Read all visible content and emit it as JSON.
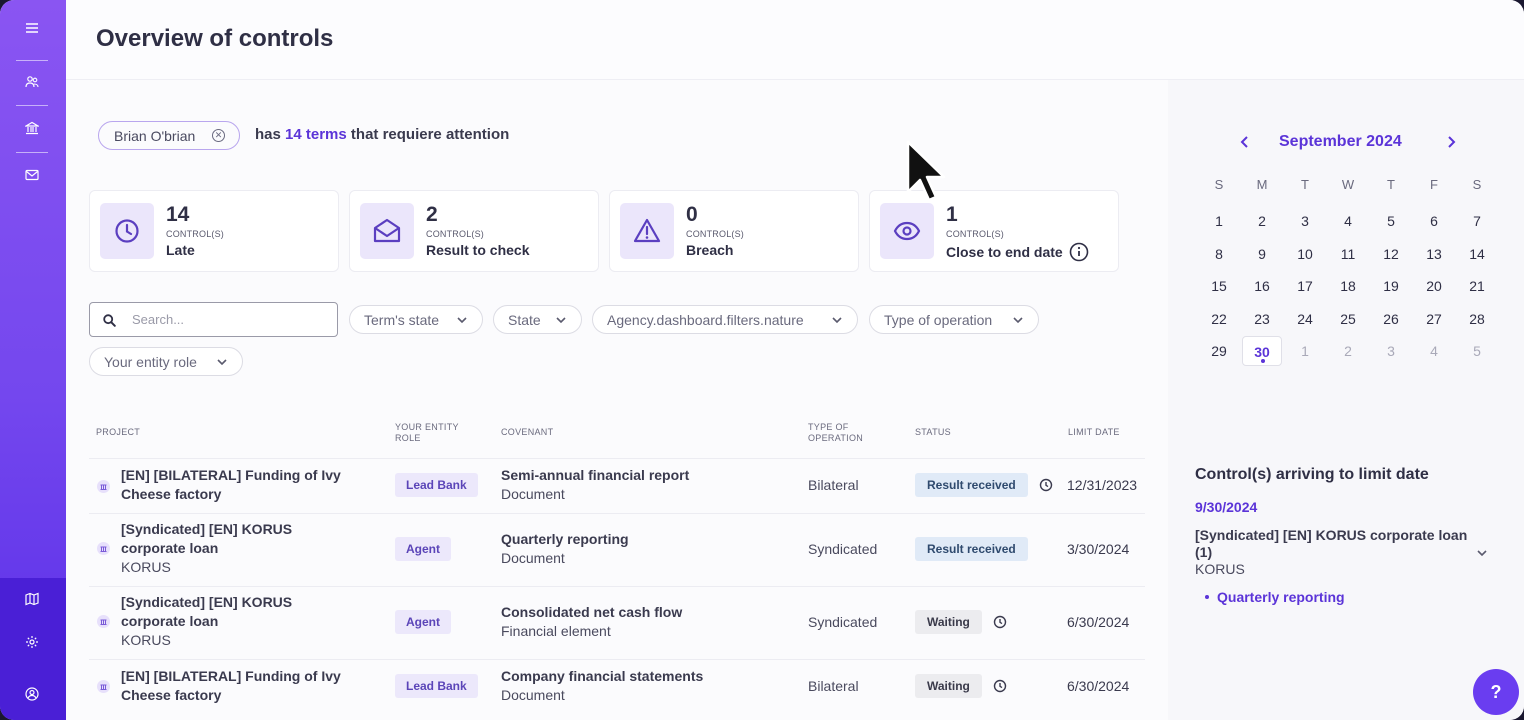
{
  "page": {
    "title": "Overview of controls"
  },
  "attention": {
    "user": "Brian O'brian",
    "prefix": "has",
    "highlight": "14 terms",
    "suffix": "that requiere attention"
  },
  "cards": [
    {
      "value": "14",
      "unit": "CONTROL(S)",
      "label": "Late",
      "icon": "clock-icon"
    },
    {
      "value": "2",
      "unit": "CONTROL(S)",
      "label": "Result to check",
      "icon": "envelope-open-icon"
    },
    {
      "value": "0",
      "unit": "CONTROL(S)",
      "label": "Breach",
      "icon": "warning-icon"
    },
    {
      "value": "1",
      "unit": "CONTROL(S)",
      "label": "Close to end date",
      "icon": "eye-icon"
    }
  ],
  "search": {
    "placeholder": "Search..."
  },
  "filters": [
    "Term's state",
    "State",
    "Agency.dashboard.filters.nature",
    "Type of operation",
    "Your entity role"
  ],
  "table": {
    "headers": {
      "project": "PROJECT",
      "role": "YOUR ENTITY ROLE",
      "covenant": "COVENANT",
      "operation": "TYPE OF OPERATION",
      "status": "STATUS",
      "limit": "LIMIT DATE"
    },
    "rows": [
      {
        "project": "[EN] [BILATERAL] Funding of Ivy Cheese factory",
        "project_sub": "",
        "role": "Lead Bank",
        "covenant": "Semi-annual financial report",
        "covenant_type": "Document",
        "operation": "Bilateral",
        "status": "Result received",
        "date": "12/31/2023"
      },
      {
        "project": "[Syndicated] [EN] KORUS corporate loan",
        "project_sub": "KORUS",
        "role": "Agent",
        "covenant": "Quarterly reporting",
        "covenant_type": "Document",
        "operation": "Syndicated",
        "status": "Result received",
        "date": "3/30/2024"
      },
      {
        "project": "[Syndicated] [EN] KORUS corporate loan",
        "project_sub": "KORUS",
        "role": "Agent",
        "covenant": "Consolidated net cash flow",
        "covenant_type": "Financial element",
        "operation": "Syndicated",
        "status": "Waiting",
        "date": "6/30/2024"
      },
      {
        "project": "[EN] [BILATERAL] Funding of Ivy Cheese factory",
        "project_sub": "",
        "role": "Lead Bank",
        "covenant": "Company financial statements",
        "covenant_type": "Document",
        "operation": "Bilateral",
        "status": "Waiting",
        "date": "6/30/2024"
      }
    ]
  },
  "calendar": {
    "month": "September 2024",
    "dow": [
      "S",
      "M",
      "T",
      "W",
      "T",
      "F",
      "S"
    ],
    "weeks": [
      [
        "1",
        "2",
        "3",
        "4",
        "5",
        "6",
        "7"
      ],
      [
        "8",
        "9",
        "10",
        "11",
        "12",
        "13",
        "14"
      ],
      [
        "15",
        "16",
        "17",
        "18",
        "19",
        "20",
        "21"
      ],
      [
        "22",
        "23",
        "24",
        "25",
        "26",
        "27",
        "28"
      ],
      [
        "29",
        "30",
        "1",
        "2",
        "3",
        "4",
        "5"
      ]
    ],
    "selected": "30"
  },
  "arriving": {
    "title": "Control(s) arriving to limit date",
    "date": "9/30/2024",
    "project": "[Syndicated] [EN] KORUS corporate loan (1)",
    "project_sub": "KORUS",
    "item": "Quarterly reporting"
  },
  "help": {
    "label": "?"
  },
  "colors": {
    "accent": "#5b34d8",
    "sidebar": "#7447ee"
  }
}
